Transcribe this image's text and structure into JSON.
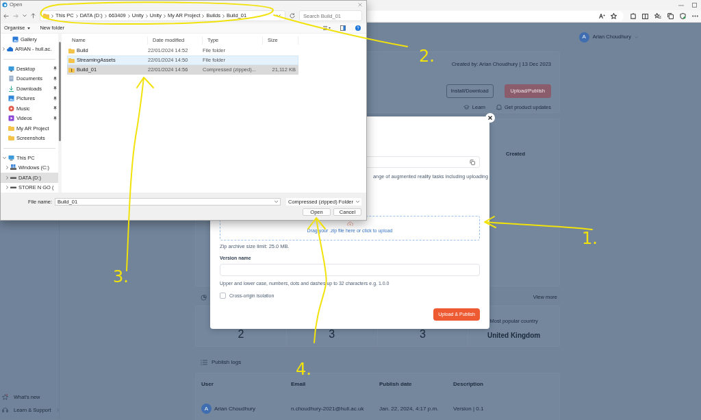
{
  "file_dialog": {
    "title": "Open",
    "breadcrumb": [
      "This PC",
      "DATA (D:)",
      "663409",
      "Unity",
      "Unity",
      "My AR Project",
      "Builds",
      "Build_01"
    ],
    "search_placeholder": "Search Build_01",
    "toolbar": [
      "Organise",
      "New folder"
    ],
    "nav_top": [
      {
        "label": "Gallery",
        "kind": "gallery",
        "selected": false
      },
      {
        "label": "ARIAN - hull.ac.",
        "kind": "cloud",
        "expanded": false,
        "selected": false
      }
    ],
    "quick_access": [
      {
        "label": "Desktop",
        "kind": "desktop",
        "pinned": true,
        "selected": false
      },
      {
        "label": "Documents",
        "kind": "documents",
        "pinned": true,
        "selected": false
      },
      {
        "label": "Downloads",
        "kind": "downloads",
        "pinned": true,
        "selected": false
      },
      {
        "label": "Pictures",
        "kind": "pictures",
        "pinned": true,
        "selected": false
      },
      {
        "label": "Music",
        "kind": "music",
        "pinned": true,
        "selected": false
      },
      {
        "label": "Videos",
        "kind": "videos",
        "pinned": true,
        "selected": false
      },
      {
        "label": "My AR Project",
        "kind": "folder",
        "pinned": false,
        "selected": false
      },
      {
        "label": "Screenshots",
        "kind": "folder",
        "pinned": false,
        "selected": false
      }
    ],
    "tree": {
      "label": "This PC",
      "kind": "pc",
      "expanded": true,
      "selected": false,
      "children": [
        {
          "label": "Windows (C:)",
          "kind": "windows_drive",
          "expanded": false,
          "selected": false
        },
        {
          "label": "DATA (D:)",
          "kind": "drive",
          "expanded": false,
          "selected": true
        },
        {
          "label": "STORE N GO (",
          "kind": "drive",
          "expanded": false,
          "selected": false
        }
      ]
    },
    "columns": [
      "Name",
      "Date modified",
      "Type",
      "Size"
    ],
    "files": [
      {
        "name": "Build",
        "date": "22/01/2024 14:52",
        "type": "File folder",
        "kind": "folder",
        "selected": false,
        "hovered": false
      },
      {
        "name": "StreamingAssets",
        "date": "22/01/2024 14:50",
        "type": "File folder",
        "kind": "folder",
        "selected": false,
        "hovered": true
      },
      {
        "name": "Build_01",
        "date": "22/01/2024 14:56",
        "type": "Compressed (zipped)...",
        "size": "21,112 KB",
        "kind": "zip",
        "selected": true,
        "hovered": false
      }
    ],
    "file_name_label": "File name:",
    "file_name": "Build_01",
    "file_type": "Compressed (zipped) Folder",
    "buttons": [
      "Open",
      "Cancel"
    ]
  },
  "page": {
    "user": {
      "initial": "A",
      "name": "Arian Choudhury"
    },
    "project_card": {
      "created": "Created by: Arian Choudhury | 13 Dec 2023",
      "buttons": [
        {
          "label": "Install/Download",
          "kind": "outline"
        },
        {
          "label": "Upload/Publish",
          "kind": "primary"
        }
      ],
      "links": [
        {
          "label": "Learn",
          "kind": "learn"
        },
        {
          "label": "Get product updates",
          "kind": "updates"
        }
      ]
    },
    "column_header": "Created",
    "analytics": {
      "view_more": "View more",
      "stats": [
        {
          "value": "2"
        },
        {
          "value": "3"
        },
        {
          "value": "3"
        },
        {
          "label": "Most popular country",
          "value": "United Kingdom"
        }
      ]
    },
    "publish_logs": {
      "title": "Publish logs",
      "columns": [
        "User",
        "Email",
        "Publish date",
        "Description"
      ],
      "rows": [
        {
          "initial": "A",
          "user": "Arian Choudhury",
          "email": "n.choudhury-2021@hull.ac.uk",
          "date": "Jan. 22, 2024, 4:17 p.m.",
          "description": "Version | 0.1"
        }
      ]
    },
    "sidebar_footer": [
      {
        "label": "What's new",
        "kind": "new"
      },
      {
        "label": "Learn & Support",
        "kind": "support"
      }
    ]
  },
  "upload_modal": {
    "description_fragment": "ange of augmented reality tasks including uploading",
    "dropzone": "Drag your .zip file here or click to upload",
    "size_limit": "Zip archive size limit: 25.0 MB.",
    "version_label": "Version name",
    "version_hint": "Upper and lower case, numbers, dots and dashes up to 32 characters e.g. 1.0.0",
    "cross_origin": {
      "label": "Cross-origin isolation",
      "checked": false
    },
    "submit": "Upload & Publish"
  },
  "annotations": [
    {
      "label": "1."
    },
    {
      "label": "2."
    },
    {
      "label": "3."
    },
    {
      "label": "4."
    }
  ]
}
